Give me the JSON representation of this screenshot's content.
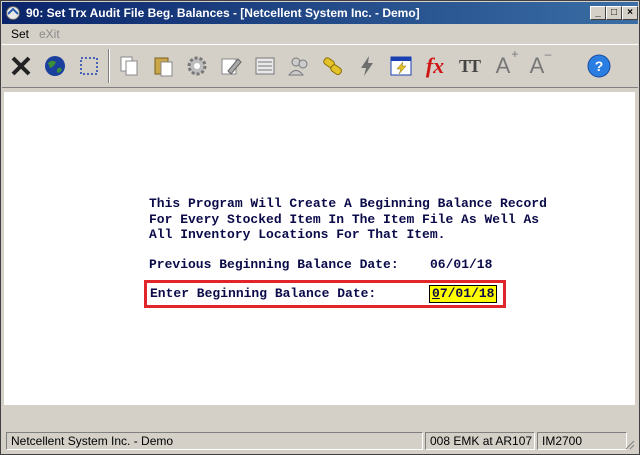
{
  "window": {
    "title": "90: Set Trx Audit File Beg. Balances - [Netcellent System Inc. - Demo]",
    "controls": {
      "minimize": "_",
      "maximize": "□",
      "close": "×"
    }
  },
  "menubar": {
    "items": [
      {
        "label": "Set",
        "enabled": true
      },
      {
        "label": "eXit",
        "enabled": false
      }
    ]
  },
  "toolbar": {
    "icons": [
      "close-x-icon",
      "globe-icon",
      "select-frame-icon",
      "copy-icon",
      "paste-icon",
      "settings-gear-icon",
      "edit-icon",
      "list-icon",
      "users-icon",
      "link-icon",
      "lightning-icon",
      "notepad-lightning-icon",
      "function-fx-icon",
      "font-size-tt-icon",
      "font-increase-icon",
      "font-decrease-icon",
      "help-icon"
    ],
    "fx_label": "fx",
    "tt_label": "TT",
    "a_plus_label": "A",
    "a_minus_label": "A"
  },
  "content": {
    "line1": "This Program Will Create A Beginning Balance Record",
    "line2": "For Every Stocked Item In The Item File As Well As",
    "line3": "All Inventory Locations For That Item.",
    "previous_label": "Previous Beginning Balance Date:",
    "previous_value": "06/01/18",
    "enter_label": "Enter Beginning Balance Date:",
    "enter_value_first": "0",
    "enter_value_rest": "7/01/18"
  },
  "statusbar": {
    "company": "Netcellent System Inc. - Demo",
    "user": "008 EMK at AR107",
    "program": "IM2700"
  }
}
